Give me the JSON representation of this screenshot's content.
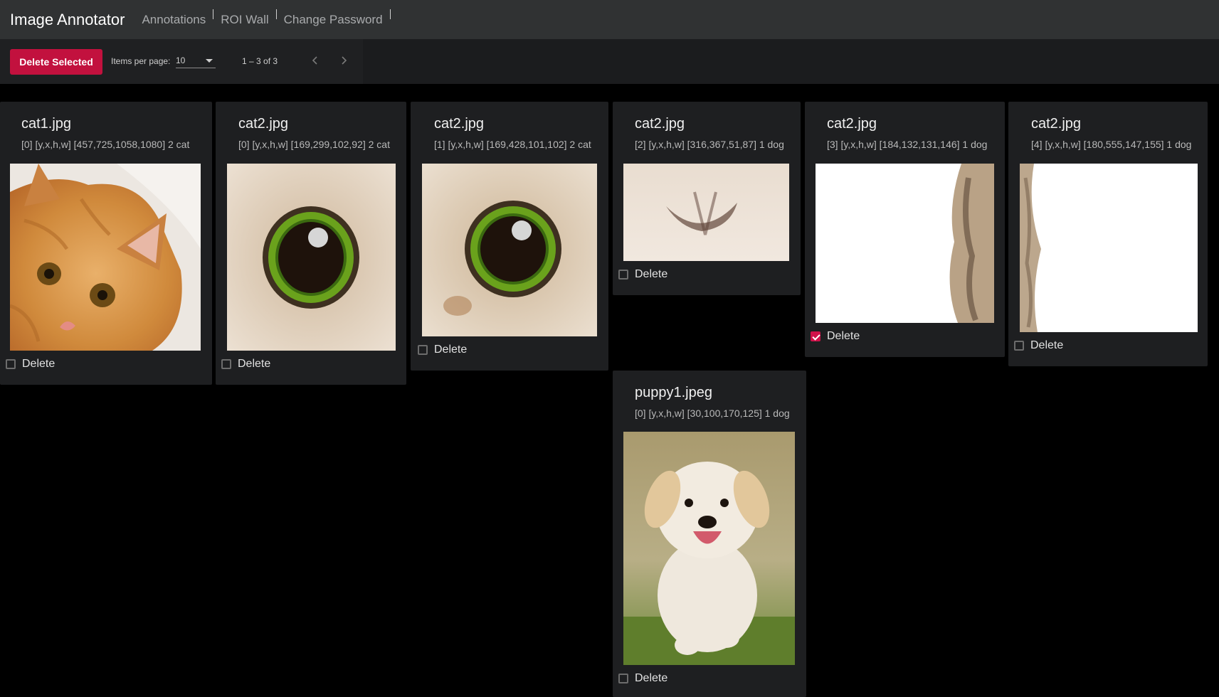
{
  "app": {
    "title": "Image Annotator"
  },
  "nav": {
    "items": [
      "Annotations",
      "ROI Wall",
      "Change Password"
    ]
  },
  "toolbar": {
    "delete_label": "Delete Selected",
    "items_per_page_label": "Items per page:",
    "items_per_page_value": "10",
    "range_label": "1 – 3 of 3"
  },
  "cards": [
    {
      "title": "cat1.jpg",
      "subtitle": "[0] [y,x,h,w] [457,725,1058,1080] 2 cat",
      "delete_label": "Delete",
      "checked": false,
      "image": "cat-face-crop"
    },
    {
      "title": "cat2.jpg",
      "subtitle": "[0] [y,x,h,w] [169,299,102,92] 2 cat",
      "delete_label": "Delete",
      "checked": false,
      "image": "cat-eye-crop"
    },
    {
      "title": "cat2.jpg",
      "subtitle": "[1] [y,x,h,w] [169,428,101,102] 2 cat",
      "delete_label": "Delete",
      "checked": false,
      "image": "cat-eye-crop"
    },
    {
      "title": "cat2.jpg",
      "subtitle": "[2] [y,x,h,w] [316,367,51,87] 1 dog",
      "delete_label": "Delete",
      "checked": false,
      "image": "fur-crop"
    },
    {
      "title": "cat2.jpg",
      "subtitle": "[3] [y,x,h,w] [184,132,131,146] 1 dog",
      "delete_label": "Delete",
      "checked": true,
      "image": "fur-edge-right-crop"
    },
    {
      "title": "cat2.jpg",
      "subtitle": "[4] [y,x,h,w] [180,555,147,155] 1 dog",
      "delete_label": "Delete",
      "checked": false,
      "image": "fur-edge-left-crop"
    },
    {
      "title": "puppy1.jpeg",
      "subtitle": "[0] [y,x,h,w] [30,100,170,125] 1 dog",
      "delete_label": "Delete",
      "checked": false,
      "image": "puppy-crop"
    }
  ],
  "colors": {
    "accent": "#c2113e",
    "topbar": "#303233",
    "card": "#1e1f21"
  }
}
